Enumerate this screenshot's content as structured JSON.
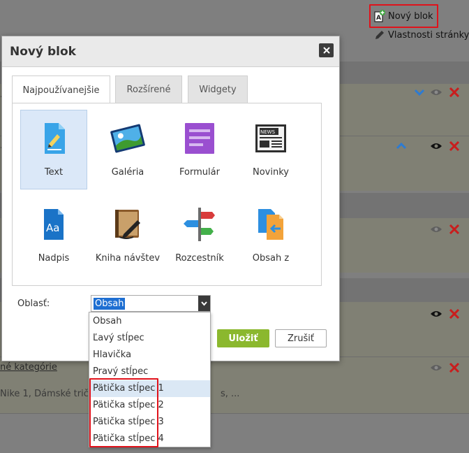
{
  "page_actions": {
    "new_block": "Nový blok",
    "page_properties": "Vlastnosti stránky"
  },
  "background": {
    "link_text": "né kategórie",
    "row_text": "Nike 1, Dámské tričk",
    "row_text_tail": "s, ..."
  },
  "modal": {
    "title": "Nový blok",
    "tabs": [
      "Najpoužívanejšie",
      "Rozšírené",
      "Widgety"
    ],
    "active_tab": "Najpoužívanejšie",
    "blocks": [
      "Text",
      "Galéria",
      "Formulár",
      "Novinky",
      "Nadpis",
      "Kniha návštev",
      "Rozcestník",
      "Obsah z"
    ],
    "selected_block": "Text",
    "news_icon_text": "NEWS",
    "heading_icon_text": "Aa",
    "area_label": "Oblasť:",
    "area_value": "Obsah",
    "area_options": [
      "Obsah",
      "Ľavý stĺpec",
      "Hlavička",
      "Pravý stĺpec",
      "Pätička stĺpec 1",
      "Pätička stĺpec 2",
      "Pätička stĺpec 3",
      "Pätička stĺpec 4"
    ],
    "hovered_option": "Pätička stĺpec 1",
    "save_label": "Uložiť",
    "cancel_label": "Zrušiť"
  },
  "colors": {
    "highlight": "#e0121b",
    "save": "#8bb82e",
    "selection": "#1e6fd2",
    "delete": "#c91d1d",
    "arrow": "#2d7bd2"
  }
}
